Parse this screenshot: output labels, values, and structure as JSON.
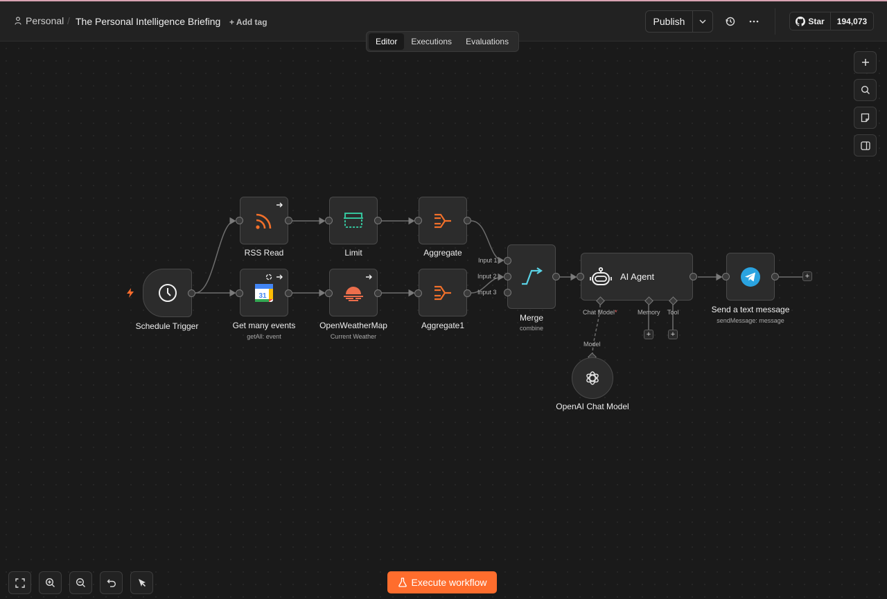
{
  "header": {
    "project": "Personal",
    "separator": "/",
    "workflow_title": "The Personal Intelligence Briefing",
    "add_tag": "+ Add tag",
    "publish_label": "Publish",
    "github_star": "Star",
    "github_count": "194,073"
  },
  "tabs": [
    "Editor",
    "Executions",
    "Evaluations"
  ],
  "active_tab": "Editor",
  "nodes": {
    "schedule": {
      "label": "Schedule Trigger"
    },
    "rss": {
      "label": "RSS Read"
    },
    "limit": {
      "label": "Limit"
    },
    "aggregate": {
      "label": "Aggregate"
    },
    "events": {
      "label": "Get many events",
      "sub": "getAll: event",
      "icon_text": "31"
    },
    "weather": {
      "label": "OpenWeatherMap",
      "sub": "Current Weather"
    },
    "aggregate1": {
      "label": "Aggregate1"
    },
    "merge": {
      "label": "Merge",
      "sub": "combine",
      "inputs": [
        "Input 1",
        "Input 2",
        "Input 3"
      ]
    },
    "agent": {
      "label": "AI Agent",
      "ports": [
        "Chat Model",
        "Memory",
        "Tool"
      ],
      "required_mark": "*"
    },
    "telegram": {
      "label": "Send a text message",
      "sub": "sendMessage: message"
    },
    "openai": {
      "label": "OpenAI Chat Model",
      "port_label": "Model"
    }
  },
  "execute_label": "Execute workflow",
  "colors": {
    "accent": "#ff6d2d",
    "rss": "#f2702a",
    "limit": "#35c39c",
    "merge": "#5ad3e6",
    "telegram": "#2aa3e0",
    "trigger": "#ff6d2d"
  }
}
